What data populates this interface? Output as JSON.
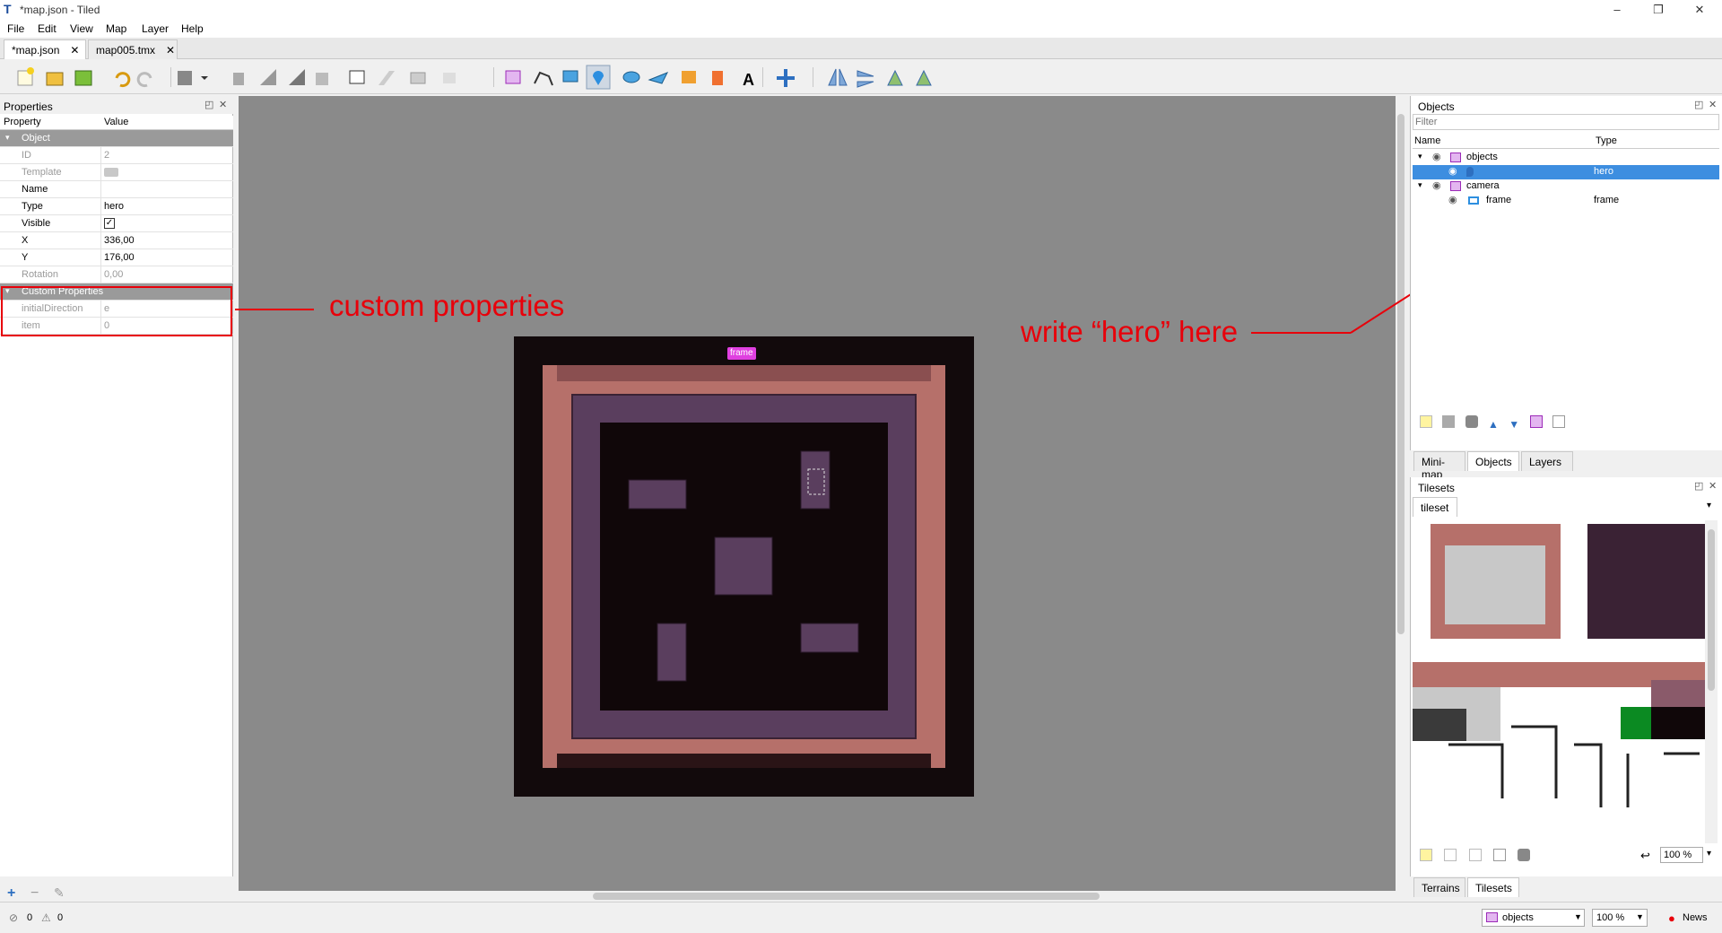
{
  "window": {
    "title": "*map.json - Tiled",
    "minimize": "–",
    "restore": "❐",
    "close": "✕"
  },
  "menu": [
    "File",
    "Edit",
    "View",
    "Map",
    "Layer",
    "Help"
  ],
  "tabs": [
    {
      "label": "*map.json",
      "close": "✕"
    },
    {
      "label": "map005.tmx",
      "close": "✕"
    }
  ],
  "toolbar": {
    "icons": [
      "new-icon",
      "open-icon",
      "save-icon",
      "undo-icon",
      "redo-icon",
      "commands-icon",
      "stamp-icon",
      "terrain-brush-icon",
      "fill-icon",
      "bucket-icon",
      "rect-select-icon",
      "magic-wand-icon",
      "select-same-icon",
      "eraser-icon",
      "select-objects-icon",
      "edit-polygon-icon",
      "insert-rect-icon",
      "insert-point-icon",
      "insert-ellipse-icon",
      "insert-polygon-icon",
      "insert-tile-icon",
      "insert-template-icon",
      "insert-text-icon",
      "move-icon",
      "flip-h-icon",
      "flip-v-icon",
      "rotate-left-icon",
      "rotate-right-icon"
    ]
  },
  "properties": {
    "title": "Properties",
    "col_property": "Property",
    "col_value": "Value",
    "group_object": "Object",
    "rows": [
      {
        "key": "ID",
        "value": "2"
      },
      {
        "key": "Template",
        "value": ""
      },
      {
        "key": "Name",
        "value": ""
      },
      {
        "key": "Type",
        "value": "hero"
      },
      {
        "key": "Visible",
        "value": "✓"
      },
      {
        "key": "X",
        "value": "336,00"
      },
      {
        "key": "Y",
        "value": "176,00"
      },
      {
        "key": "Rotation",
        "value": "0,00"
      }
    ],
    "group_custom": "Custom Properties",
    "custom_rows": [
      {
        "key": "initialDirection",
        "value": "e"
      },
      {
        "key": "item",
        "value": "0"
      }
    ]
  },
  "annotations": {
    "custom": "custom properties",
    "hero": "write “hero” here"
  },
  "map": {
    "frame_label": "frame"
  },
  "objects_panel": {
    "title": "Objects",
    "filter_placeholder": "Filter",
    "col_name": "Name",
    "col_type": "Type",
    "rows": [
      {
        "name": "objects",
        "type": ""
      },
      {
        "name": "",
        "type": "hero"
      },
      {
        "name": "camera",
        "type": ""
      },
      {
        "name": "frame",
        "type": "frame"
      }
    ],
    "bottom_tabs": [
      "Mini-map",
      "Objects",
      "Layers"
    ]
  },
  "tilesets_panel": {
    "title": "Tilesets",
    "tab": "tileset",
    "zoom": "100 %",
    "bottom_tabs": [
      "Terrains",
      "Tilesets"
    ]
  },
  "status": {
    "errors": "0",
    "warnings": "0",
    "layer": "objects",
    "zoom": "100 %",
    "news": "News"
  },
  "colors": {
    "accent": "#e040e0",
    "selection": "#3d8ee0",
    "annotation": "#e8000a"
  }
}
